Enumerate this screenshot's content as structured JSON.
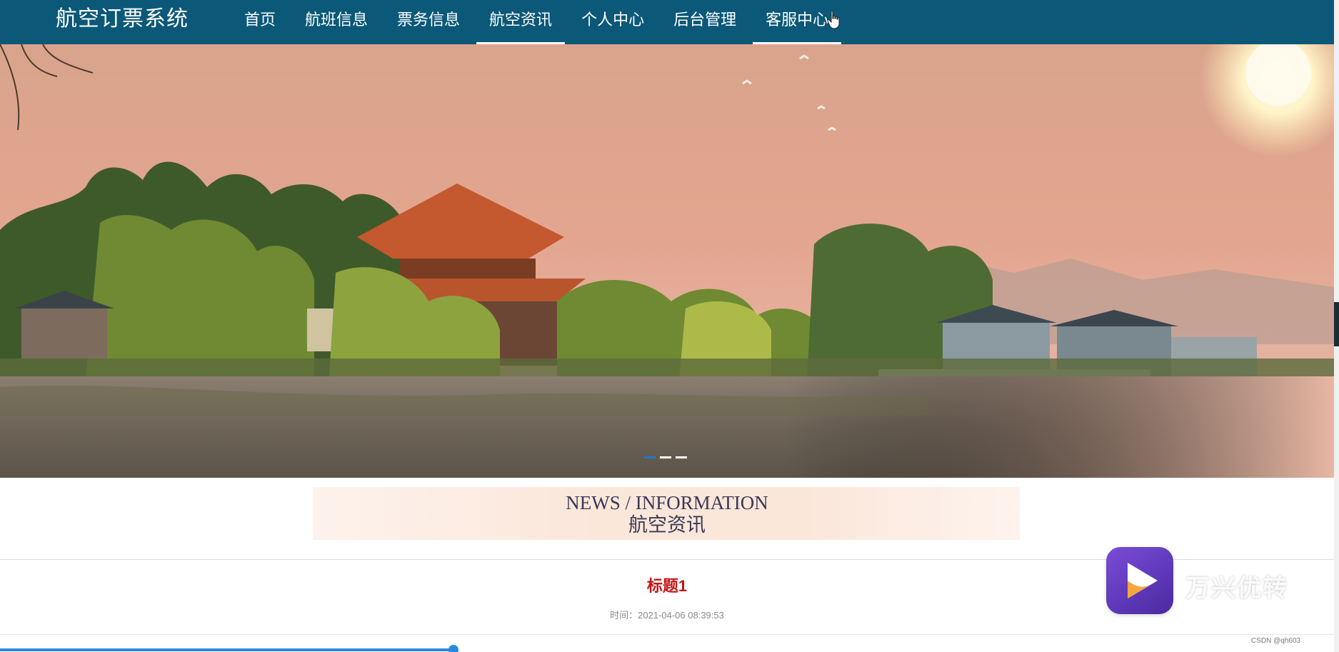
{
  "header": {
    "brand": "航空订票系统",
    "nav": [
      {
        "label": "首页",
        "active": false
      },
      {
        "label": "航班信息",
        "active": false
      },
      {
        "label": "票务信息",
        "active": false
      },
      {
        "label": "航空资讯",
        "active": true
      },
      {
        "label": "个人中心",
        "active": false
      },
      {
        "label": "后台管理",
        "active": false
      },
      {
        "label": "客服中心",
        "active": true
      }
    ]
  },
  "banner": {
    "slides": 3,
    "active_slide": 0
  },
  "section": {
    "title_en": "NEWS / INFORMATION",
    "title_cn": "航空资讯"
  },
  "news": {
    "items": [
      {
        "title": "标题1",
        "time": "时间：2021-04-06 08:39:53"
      }
    ]
  },
  "player": {
    "label": "万兴优转"
  },
  "playback": {
    "progress_fraction": 0.34
  },
  "watermark": "CSDN @qh603",
  "colors": {
    "nav_bg": "#0b5878",
    "news_title": "#c41616",
    "accent": "#2a8ae0"
  }
}
